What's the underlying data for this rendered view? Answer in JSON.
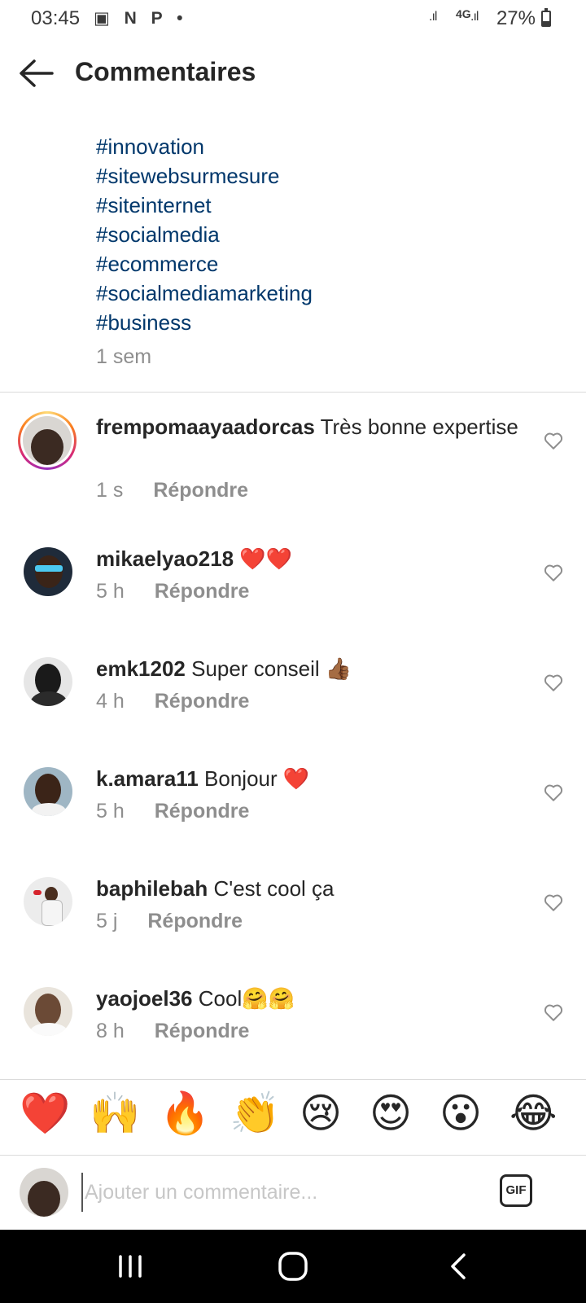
{
  "status_bar": {
    "time": "03:45",
    "notification_icons": "▣ N P •",
    "network": "4G",
    "battery": "27%"
  },
  "header": {
    "title": "Commentaires",
    "back_icon": "arrow-left-icon"
  },
  "caption": {
    "hashtags": [
      "#innovation",
      "#sitewebsurmesure",
      "#siteinternet",
      "#socialmedia",
      "#ecommerce",
      "#socialmediamarketing",
      "#business"
    ],
    "time": "1 sem"
  },
  "comments": [
    {
      "username": "frempomaayaadorcas",
      "text": "Très bonne expertise",
      "time": "1 s",
      "reply_label": "Répondre"
    },
    {
      "username": "mikaelyao218",
      "text": "❤️❤️",
      "time": "5 h",
      "reply_label": "Répondre"
    },
    {
      "username": "emk1202",
      "text": "Super conseil 👍🏾",
      "time": "4 h",
      "reply_label": "Répondre"
    },
    {
      "username": "k.amara11",
      "text": "Bonjour ❤️",
      "time": "5 h",
      "reply_label": "Répondre"
    },
    {
      "username": "baphilebah",
      "text": "C'est cool ça",
      "time": "5 j",
      "reply_label": "Répondre"
    },
    {
      "username": "yaojoel36",
      "text": "Cool🤗🤗",
      "time": "8 h",
      "reply_label": "Répondre"
    }
  ],
  "emoji_reactions": [
    "❤️",
    "🙌",
    "🔥",
    "👏",
    "😢",
    "😍",
    "😮",
    "😂"
  ],
  "comment_input": {
    "placeholder": "Ajouter un commentaire...",
    "gif_label": "GIF"
  },
  "colors": {
    "hashtag": "#00376b",
    "secondary_text": "#8e8e8e",
    "divider": "#dbdbdb",
    "nav_bar": "#000000"
  }
}
